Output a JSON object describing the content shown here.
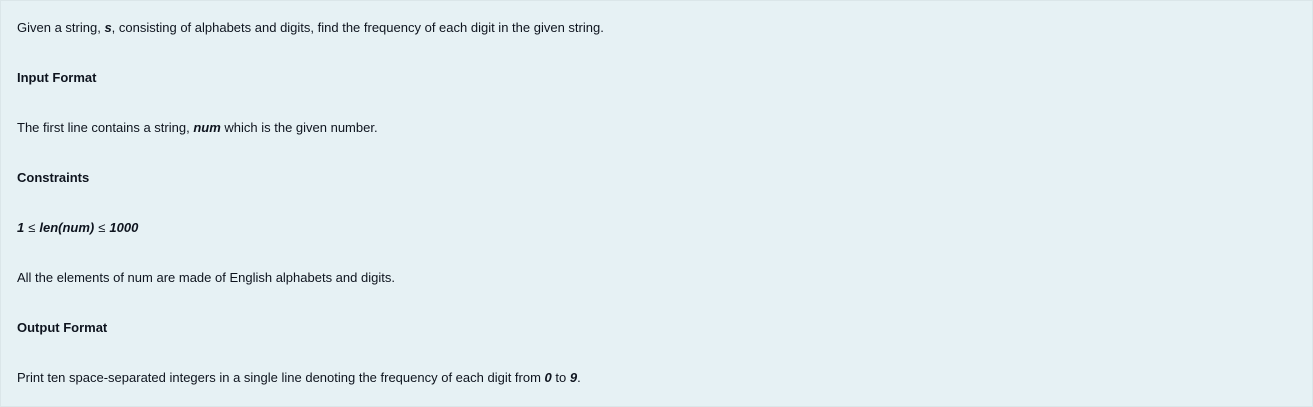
{
  "problem": {
    "intro": {
      "pre": "Given a string, ",
      "var": "s",
      "post": ", consisting of alphabets and digits, find the frequency of each digit in the given string."
    },
    "input_heading": "Input Format",
    "input_text": {
      "pre": "The first line contains a string, ",
      "var": "num",
      "post": " which is the given number."
    },
    "constraints_heading": "Constraints",
    "constraint": {
      "low": "1",
      "rel1": "≤",
      "expr": "len(num)",
      "rel2": "≤",
      "high": "1000"
    },
    "constraint_note": "All the elements of num are made of English alphabets and digits.",
    "output_heading": "Output Format",
    "output_text": {
      "pre": "Print ten space-separated integers in a single line denoting the frequency of each digit from ",
      "from": "0",
      "mid": " to ",
      "to": "9",
      "post": "."
    }
  }
}
